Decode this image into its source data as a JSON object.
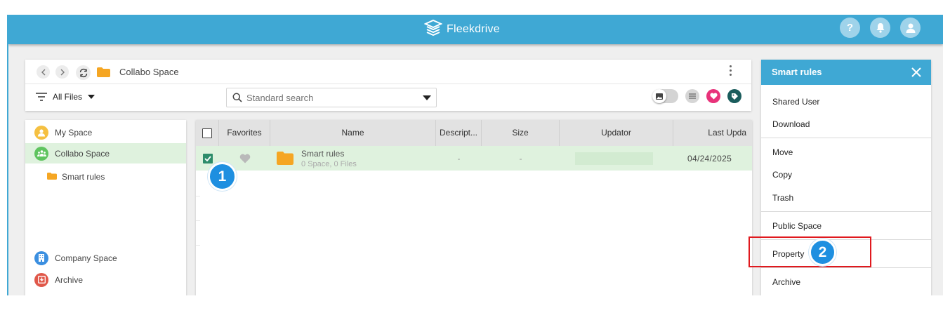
{
  "app": {
    "brand_name": "Fleekdrive"
  },
  "header": {
    "icons": [
      "help-icon",
      "notification-bell-icon",
      "user-avatar-icon"
    ],
    "help_glyph": "?"
  },
  "toolbar": {
    "breadcrumb": "Collabo Space",
    "filter_label": "All Files",
    "search_placeholder": "Standard search"
  },
  "sidebar": {
    "items": [
      {
        "label": "My Space",
        "icon": "user-icon",
        "color": "#f5c041"
      },
      {
        "label": "Collabo Space",
        "icon": "group-icon",
        "color": "#5fc45f",
        "active": true
      },
      {
        "label": "Smart rules",
        "icon": "folder-icon",
        "color": "#f5a623",
        "child": true
      },
      {
        "label": "Company Space",
        "icon": "building-icon",
        "color": "#3b8fe0"
      },
      {
        "label": "Archive",
        "icon": "archive-icon",
        "color": "#e0584a"
      }
    ]
  },
  "table": {
    "columns": [
      "Favorites",
      "Name",
      "Descript...",
      "Size",
      "Updator",
      "Last Upda"
    ],
    "rows": [
      {
        "selected": true,
        "name": "Smart rules",
        "subtitle": "0 Space, 0 Files",
        "description": "-",
        "size": "-",
        "updator": "",
        "last_updated": "04/24/2025"
      }
    ]
  },
  "panel": {
    "title": "Smart rules",
    "groups": [
      [
        "Shared User",
        "Download"
      ],
      [
        "Move",
        "Copy",
        "Trash"
      ],
      [
        "Public Space"
      ],
      [
        "Property"
      ],
      [
        "Archive"
      ]
    ]
  },
  "annotations": {
    "step1": "1",
    "step2": "2"
  },
  "colors": {
    "accent": "#3fa8d4",
    "selected_row": "#dff2de",
    "checkbox_on": "#2d8c6a",
    "highlight": "#e0191e",
    "step_badge": "#1e8fe0"
  }
}
